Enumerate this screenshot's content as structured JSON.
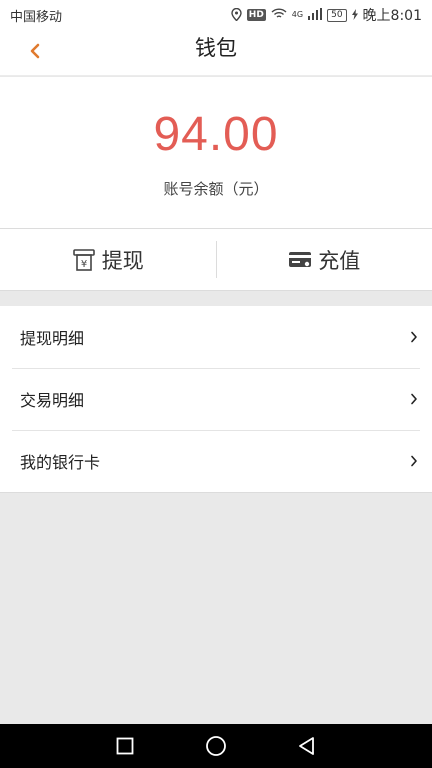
{
  "status_bar": {
    "carrier": "中国移动",
    "hd": "HD",
    "network": "4G",
    "battery": "50",
    "time": "晚上8:01"
  },
  "header": {
    "title": "钱包",
    "back_icon": "chevron-left-icon",
    "accent_color": "#e07a2e"
  },
  "balance": {
    "amount": "94.00",
    "label": "账号余额（元）",
    "amount_color": "#e35d55"
  },
  "actions": [
    {
      "label": "提现",
      "icon": "withdraw-icon"
    },
    {
      "label": "充值",
      "icon": "card-icon"
    }
  ],
  "menu": [
    {
      "label": "提现明细"
    },
    {
      "label": "交易明细"
    },
    {
      "label": "我的银行卡"
    }
  ]
}
